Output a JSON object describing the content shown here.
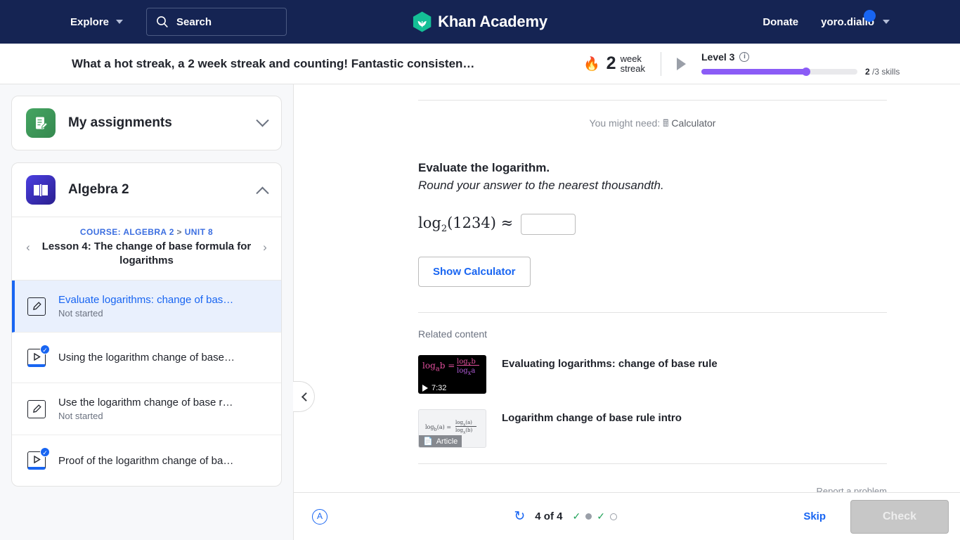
{
  "topnav": {
    "explore_label": "Explore",
    "search_placeholder": "Search",
    "brand_name": "Khan Academy",
    "donate_label": "Donate",
    "username": "yoro.diallo"
  },
  "streak": {
    "message": "What a hot streak, a 2 week streak and counting! Fantastic consisten…",
    "count": "2",
    "unit_line1": "week",
    "unit_line2": "streak",
    "level_label": "Level 3",
    "info_glyph": "i",
    "progress_percent": 67,
    "skills_done": "2",
    "skills_total": "/3 skills",
    "fill_color": "#8b5cf6"
  },
  "sidebar": {
    "assignments": {
      "title": "My assignments",
      "icon": "assignment-icon",
      "expanded": false
    },
    "course": {
      "title": "Algebra 2",
      "icon": "book-icon",
      "expanded": true,
      "breadcrumb_course": "COURSE: ALGEBRA 2",
      "breadcrumb_sep": ">",
      "breadcrumb_unit": "UNIT 8",
      "lesson_name": "Lesson 4: The change of base formula for logarithms",
      "prev_glyph": "‹",
      "next_glyph": "›"
    },
    "lessons": [
      {
        "title": "Evaluate logarithms: change of bas…",
        "status": "Not started",
        "type": "exercise",
        "completed": false,
        "active": true
      },
      {
        "title": "Using the logarithm change of base…",
        "status": "",
        "type": "video",
        "completed": true,
        "active": false
      },
      {
        "title": "Use the logarithm change of base r…",
        "status": "Not started",
        "type": "exercise",
        "completed": false,
        "active": false
      },
      {
        "title": "Proof of the logarithm change of ba…",
        "status": "",
        "type": "video",
        "completed": true,
        "active": false
      }
    ]
  },
  "exercise": {
    "might_need_prefix": "You might need:",
    "calculator_label": "Calculator",
    "question_title": "Evaluate the logarithm.",
    "question_sub": "Round your answer to the nearest thousandth.",
    "math_prefix": "log",
    "math_base": "2",
    "math_arg": "(1234)",
    "math_approx": "≈",
    "answer_value": "",
    "show_calculator_label": "Show Calculator",
    "related_label": "Related content",
    "related": [
      {
        "title": "Evaluating logarithms: change of base rule",
        "kind": "video",
        "meta": "7:32"
      },
      {
        "title": "Logarithm change of base rule intro",
        "kind": "article",
        "meta": "Article"
      }
    ],
    "report_label": "Report a problem"
  },
  "bottombar": {
    "accessibility_glyph": "A",
    "refresh_glyph": "↻",
    "question_count": "4 of 4",
    "dots": [
      "correct",
      "current",
      "correct",
      "empty"
    ],
    "skip_label": "Skip",
    "check_label": "Check"
  }
}
